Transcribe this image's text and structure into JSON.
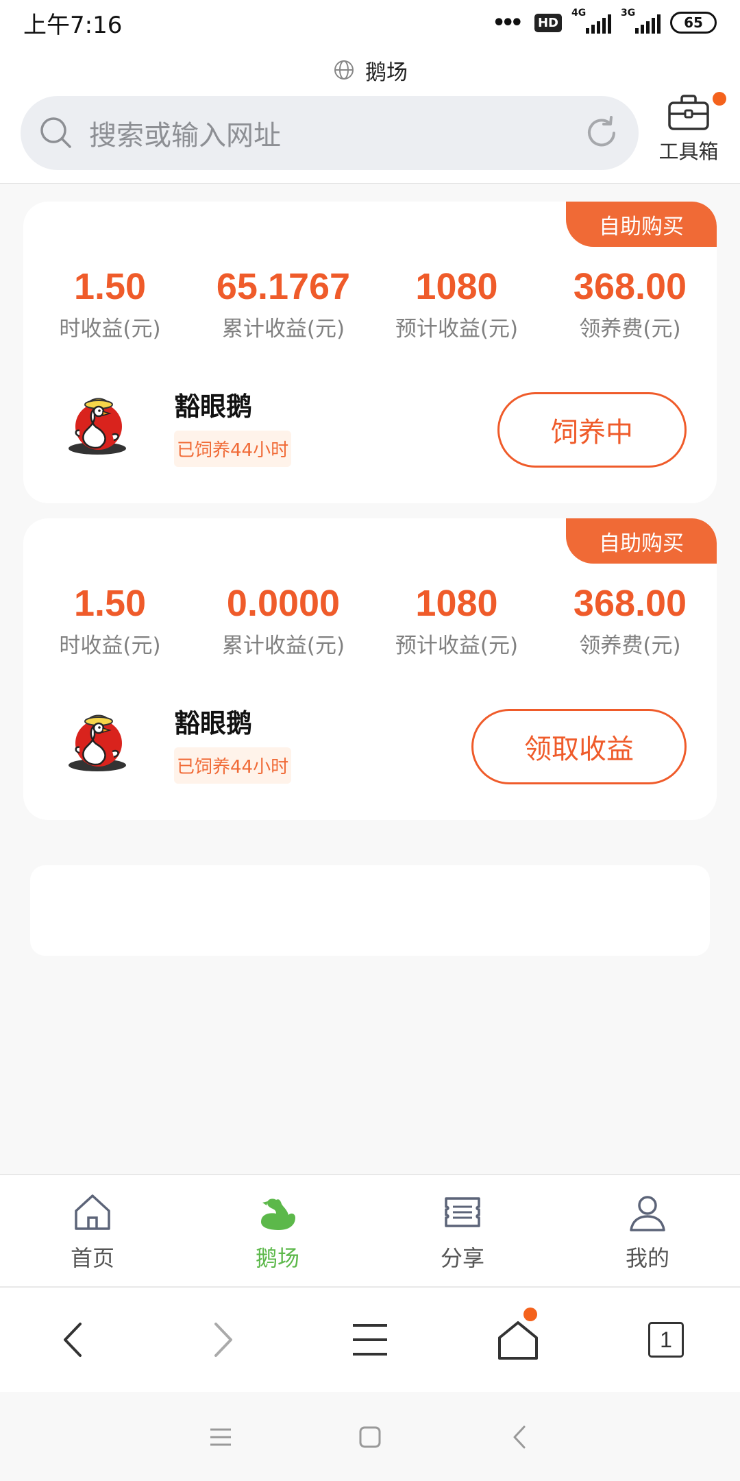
{
  "status_bar": {
    "time": "上午7:16",
    "hd": "HD",
    "network_1": "4G",
    "network_2": "3G",
    "battery": "65"
  },
  "browser": {
    "site_title": "鹅场",
    "search_placeholder": "搜索或输入网址",
    "toolbox_label": "工具箱"
  },
  "cards": [
    {
      "badge": "自助购买",
      "stats": [
        {
          "value": "1.50",
          "label": "时收益(元)"
        },
        {
          "value": "65.1767",
          "label": "累计收益(元)"
        },
        {
          "value": "1080",
          "label": "预计收益(元)"
        },
        {
          "value": "368.00",
          "label": "领养费(元)"
        }
      ],
      "goose_name": "豁眼鹅",
      "goose_status": "已饲养44小时",
      "action_label": "饲养中"
    },
    {
      "badge": "自助购买",
      "stats": [
        {
          "value": "1.50",
          "label": "时收益(元)"
        },
        {
          "value": "0.0000",
          "label": "累计收益(元)"
        },
        {
          "value": "1080",
          "label": "预计收益(元)"
        },
        {
          "value": "368.00",
          "label": "领养费(元)"
        }
      ],
      "goose_name": "豁眼鹅",
      "goose_status": "已饲养44小时",
      "action_label": "领取收益"
    }
  ],
  "tabs": [
    {
      "label": "首页",
      "icon": "home-icon"
    },
    {
      "label": "鹅场",
      "icon": "goose-icon",
      "active": true
    },
    {
      "label": "分享",
      "icon": "share-icon"
    },
    {
      "label": "我的",
      "icon": "user-icon"
    }
  ],
  "browser_nav": {
    "tab_count": "1"
  },
  "colors": {
    "accent": "#ef5b2a",
    "active_tab": "#5cb84a",
    "notification": "#f4621c"
  }
}
